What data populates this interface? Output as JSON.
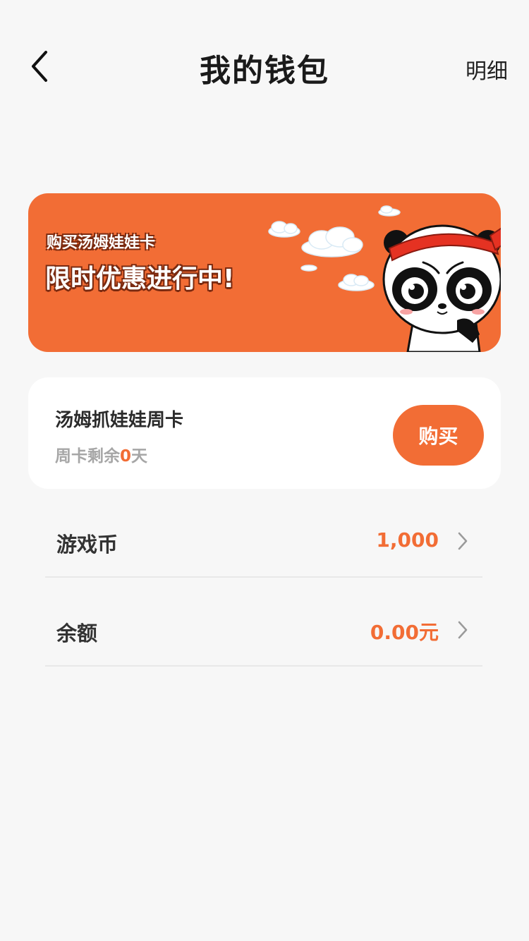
{
  "header": {
    "title": "我的钱包",
    "detail_label": "明细"
  },
  "banner": {
    "subtitle": "购买汤姆娃娃卡",
    "title": "限时优惠进行中!"
  },
  "card": {
    "title": "汤姆抓娃娃周卡",
    "remaining_prefix": "周卡剩余",
    "remaining_days": "0",
    "remaining_suffix": "天",
    "buy_label": "购买"
  },
  "wallet": {
    "rows": [
      {
        "label": "游戏币",
        "value": "1,000"
      },
      {
        "label": "余额",
        "value": "0.00元"
      }
    ]
  },
  "colors": {
    "accent": "#f26d35",
    "background": "#f7f7f7",
    "card": "#ffffff"
  },
  "icons": [
    "chevron-left-icon",
    "chevron-right-icon",
    "panda-mascot",
    "cloud"
  ]
}
